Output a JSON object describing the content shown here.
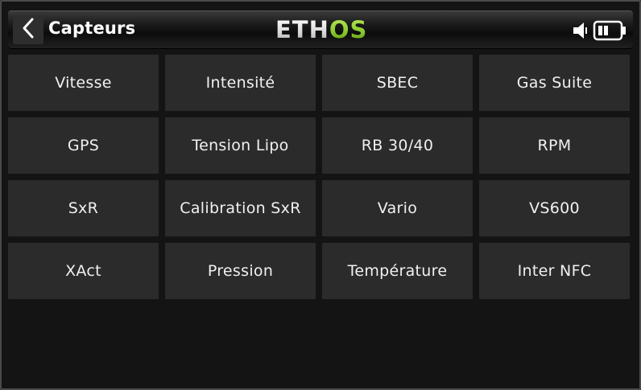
{
  "header": {
    "title": "Capteurs",
    "back_icon": "chevron-left-icon",
    "logo": {
      "part1": "ETH",
      "part2": "OS"
    },
    "status": {
      "speaker_icon": "speaker-icon",
      "battery_icon": "battery-icon",
      "battery_level": 0.5
    }
  },
  "colors": {
    "background": "#141414",
    "tile": "#2b2b2b",
    "text": "#f0f0f0",
    "logo_accent": "#8ccb2e"
  },
  "sensors": [
    {
      "label": "Vitesse"
    },
    {
      "label": "Intensité"
    },
    {
      "label": "SBEC"
    },
    {
      "label": "Gas Suite"
    },
    {
      "label": "GPS"
    },
    {
      "label": "Tension Lipo"
    },
    {
      "label": "RB 30/40"
    },
    {
      "label": "RPM"
    },
    {
      "label": "SxR"
    },
    {
      "label": "Calibration SxR"
    },
    {
      "label": "Vario"
    },
    {
      "label": "VS600"
    },
    {
      "label": "XAct"
    },
    {
      "label": "Pression"
    },
    {
      "label": "Température"
    },
    {
      "label": "Inter NFC"
    }
  ]
}
